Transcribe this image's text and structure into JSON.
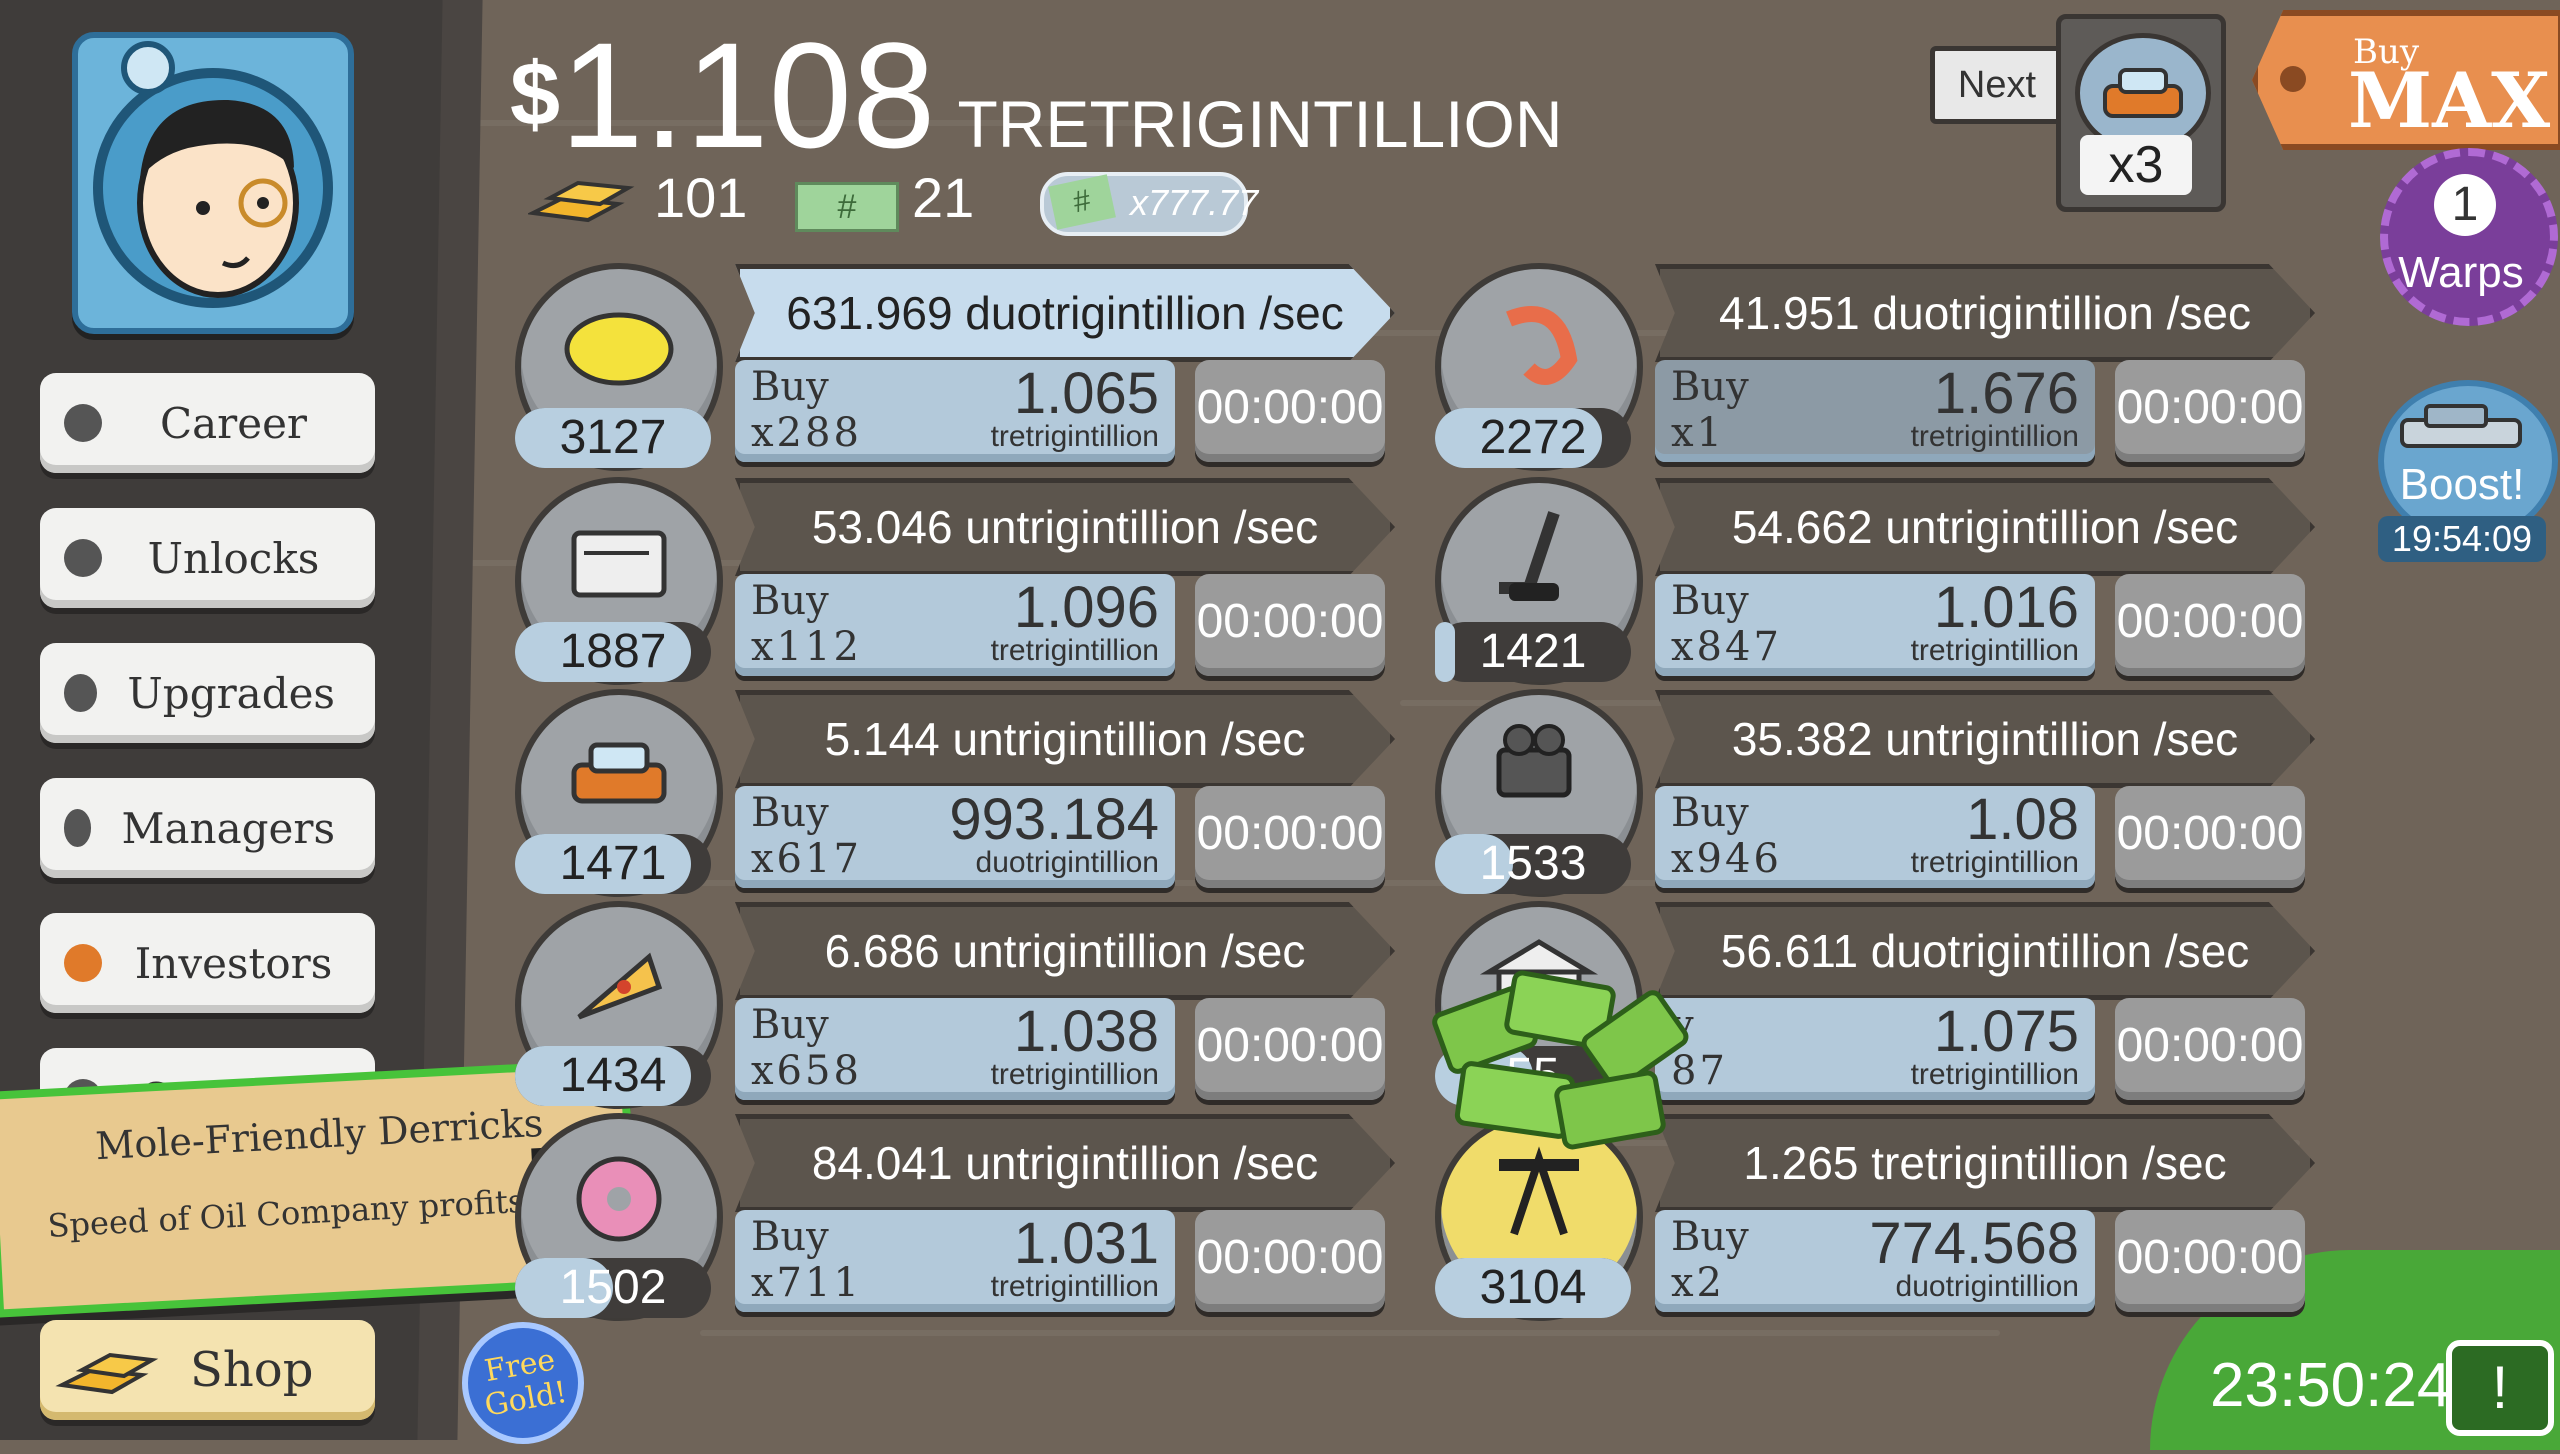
{
  "header": {
    "currency_symbol": "$",
    "money_value": "1.108",
    "money_unit": "TRETRIGINTILLION",
    "gold_bars": "101",
    "mega_tickets": "21",
    "mega_multiplier": "x777.77"
  },
  "sidebar": {
    "items": [
      {
        "label": "Career"
      },
      {
        "label": "Unlocks"
      },
      {
        "label": "Upgrades"
      },
      {
        "label": "Managers"
      },
      {
        "label": "Investors"
      },
      {
        "label": "Compact"
      }
    ],
    "shop_label": "Shop",
    "free_gold_line1": "Free",
    "free_gold_line2": "Gold!"
  },
  "banner": {
    "title": "Mole-Friendly Derricks",
    "subtitle": "Speed of Oil Company profits x2"
  },
  "top_right": {
    "next_label": "Next",
    "next_multiplier": "x3",
    "buy_label": "Buy",
    "max_label": "MAX",
    "warps_count": "1",
    "warps_label": "Warps",
    "boost_label": "Boost!",
    "boost_timer": "19:54:09",
    "event_timer": "23:50:24"
  },
  "businesses": [
    {
      "icon": "lemon-icon",
      "count": "3127",
      "progress": 1.0,
      "rate": "631.969 duotrigintillion /sec",
      "buy_word": "Buy",
      "buy_qty": "x288",
      "price": "1.065",
      "price_unit": "tretrigintillion",
      "timer": "00:00:00",
      "lit": true
    },
    {
      "icon": "shrimp-icon",
      "count": "2272",
      "progress": 0.85,
      "rate": "41.951 duotrigintillion /sec",
      "buy_word": "Buy",
      "buy_qty": "x1",
      "price": "1.676",
      "price_unit": "tretrigintillion",
      "timer": "00:00:00",
      "lit": false
    },
    {
      "icon": "newspaper-icon",
      "count": "1887",
      "progress": 0.9,
      "rate": "53.046 untrigintillion /sec",
      "buy_word": "Buy",
      "buy_qty": "x112",
      "price": "1.096",
      "price_unit": "tretrigintillion",
      "timer": "00:00:00",
      "lit": false
    },
    {
      "icon": "hockey-icon",
      "count": "1421",
      "progress": 0.1,
      "rate": "54.662 untrigintillion /sec",
      "buy_word": "Buy",
      "buy_qty": "x847",
      "price": "1.016",
      "price_unit": "tretrigintillion",
      "timer": "00:00:00",
      "lit": false
    },
    {
      "icon": "car-icon",
      "count": "1471",
      "progress": 0.9,
      "rate": "5.144 untrigintillion /sec",
      "buy_word": "Buy",
      "buy_qty": "x617",
      "price": "993.184",
      "price_unit": "duotrigintillion",
      "timer": "00:00:00",
      "lit": false
    },
    {
      "icon": "movie-camera-icon",
      "count": "1533",
      "progress": 0.4,
      "rate": "35.382 untrigintillion /sec",
      "buy_word": "Buy",
      "buy_qty": "x946",
      "price": "1.08",
      "price_unit": "tretrigintillion",
      "timer": "00:00:00",
      "lit": false
    },
    {
      "icon": "pizza-icon",
      "count": "1434",
      "progress": 0.9,
      "rate": "6.686 untrigintillion /sec",
      "buy_word": "Buy",
      "buy_qty": "x658",
      "price": "1.038",
      "price_unit": "tretrigintillion",
      "timer": "00:00:00",
      "lit": false
    },
    {
      "icon": "bank-icon",
      "count": "55",
      "progress": 0.5,
      "rate": "56.611 duotrigintillion /sec",
      "buy_word": "y",
      "buy_qty": "87",
      "price": "1.075",
      "price_unit": "tretrigintillion",
      "timer": "00:00:00",
      "lit": false
    },
    {
      "icon": "donut-icon",
      "count": "1502",
      "progress": 0.5,
      "rate": "84.041 untrigintillion /sec",
      "buy_word": "Buy",
      "buy_qty": "x711",
      "price": "1.031",
      "price_unit": "tretrigintillion",
      "timer": "00:00:00",
      "lit": false
    },
    {
      "icon": "oil-derrick-icon",
      "count": "3104",
      "progress": 1.0,
      "rate": "1.265 tretrigintillion /sec",
      "buy_word": "Buy",
      "buy_qty": "x2",
      "price": "774.568",
      "price_unit": "duotrigintillion",
      "timer": "00:00:00",
      "lit": false
    }
  ]
}
